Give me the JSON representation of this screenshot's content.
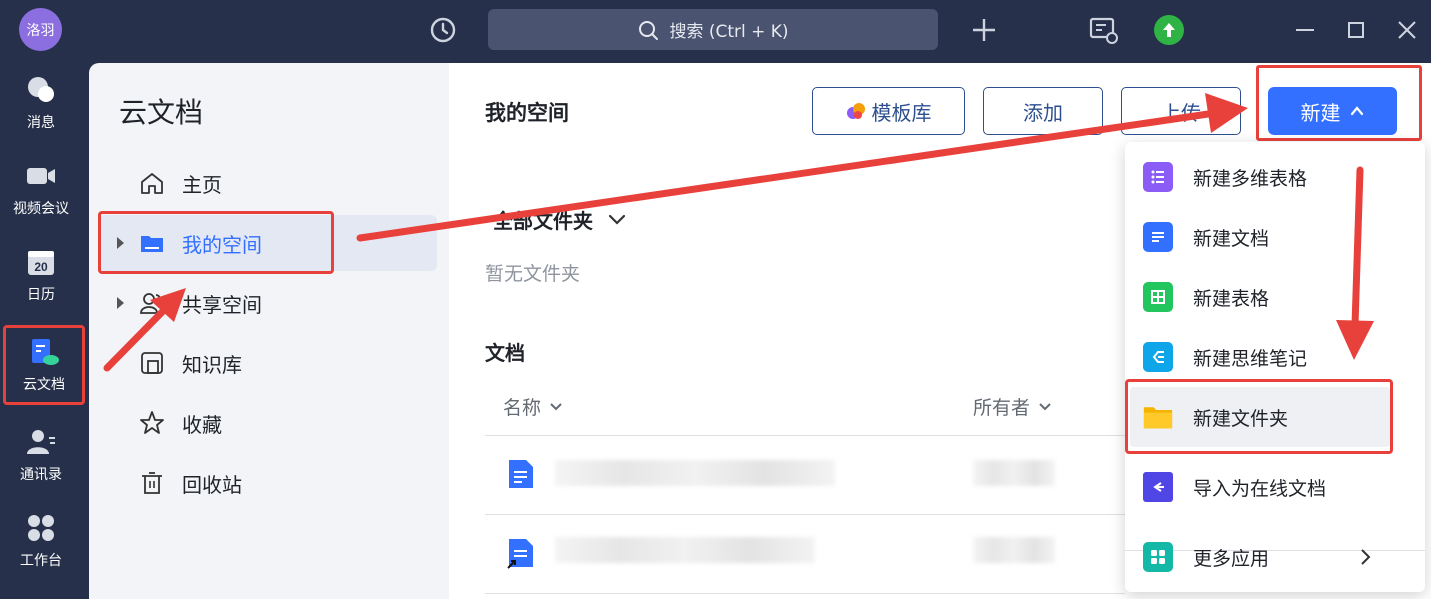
{
  "topbar": {
    "avatar_text": "洛羽",
    "search_text": "搜索 (Ctrl + K)"
  },
  "rail": {
    "items": [
      {
        "label": "消息",
        "icon": "chat-icon"
      },
      {
        "label": "视频会议",
        "icon": "video-icon"
      },
      {
        "label": "日历",
        "icon": "calendar-icon",
        "day": "20"
      },
      {
        "label": "云文档",
        "icon": "cloud-doc-icon"
      },
      {
        "label": "通讯录",
        "icon": "contacts-icon"
      },
      {
        "label": "工作台",
        "icon": "workbench-icon"
      }
    ]
  },
  "sidebar": {
    "title": "云文档",
    "items": [
      {
        "label": "主页",
        "icon": "home-icon"
      },
      {
        "label": "我的空间",
        "icon": "folder-icon"
      },
      {
        "label": "共享空间",
        "icon": "shared-users-icon"
      },
      {
        "label": "知识库",
        "icon": "knowledge-icon"
      },
      {
        "label": "收藏",
        "icon": "star-icon"
      },
      {
        "label": "回收站",
        "icon": "trash-icon"
      }
    ]
  },
  "main": {
    "title": "我的空间",
    "buttons": {
      "template": "模板库",
      "add": "添加",
      "upload": "上传",
      "new": "新建"
    },
    "folders_heading": "全部文件夹",
    "folders_empty": "暂无文件夹",
    "docs_heading": "文档",
    "columns": {
      "name": "名称",
      "owner": "所有者"
    }
  },
  "dropdown": {
    "items": [
      {
        "label": "新建多维表格",
        "icon": "bitable-icon",
        "color": "#8b5cf6"
      },
      {
        "label": "新建文档",
        "icon": "doc-icon",
        "color": "#3370ff"
      },
      {
        "label": "新建表格",
        "icon": "sheet-icon",
        "color": "#22c55e"
      },
      {
        "label": "新建思维笔记",
        "icon": "mindnote-icon",
        "color": "#0ea5e9"
      },
      {
        "label": "新建文件夹",
        "icon": "folder-icon",
        "color": "#f5b400"
      },
      {
        "label": "导入为在线文档",
        "icon": "import-icon",
        "color": "#4f46e5"
      },
      {
        "label": "更多应用",
        "icon": "apps-icon",
        "color": "#14b8a6"
      }
    ]
  },
  "colors": {
    "accent": "#3370ff",
    "annotation": "#e8413c",
    "topbar": "#26304a"
  }
}
